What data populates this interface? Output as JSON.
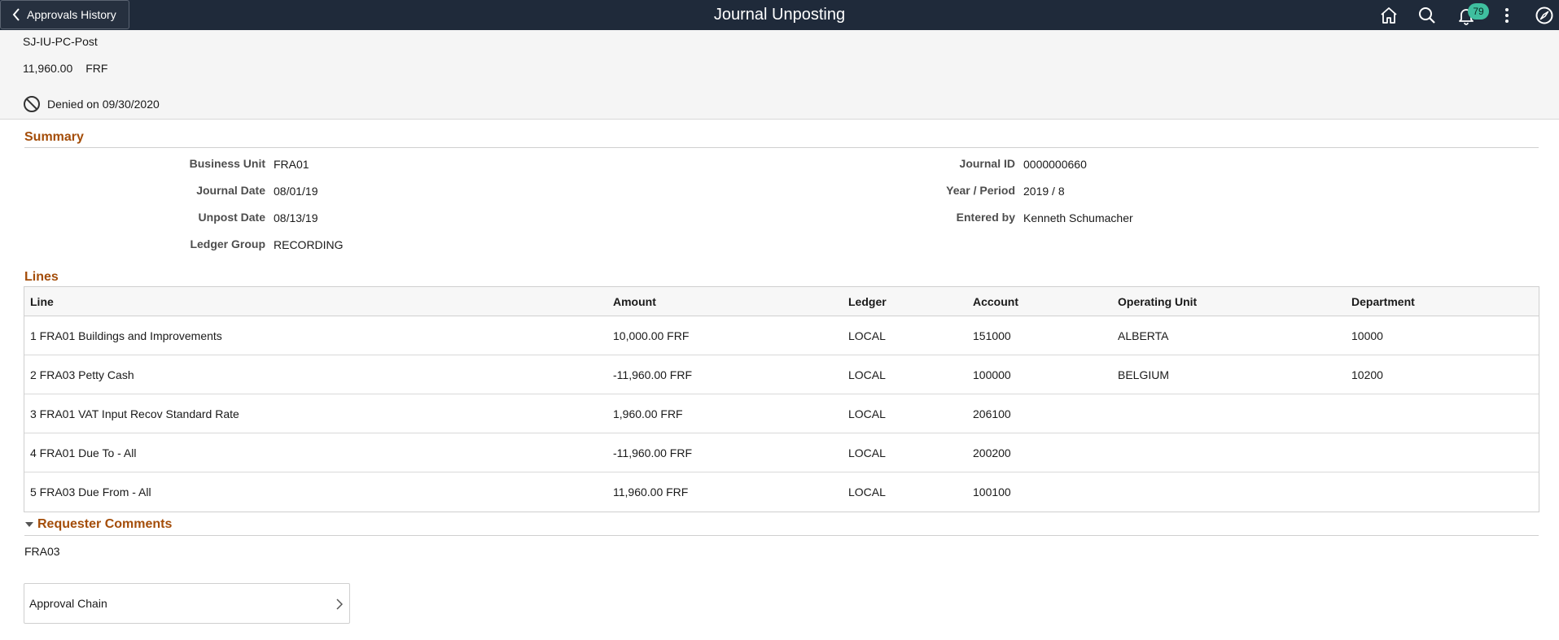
{
  "banner": {
    "back_label": "Approvals History",
    "title": "Journal Unposting",
    "notification_count": "79",
    "icons": [
      "home-icon",
      "search-icon",
      "bell-icon",
      "more-vertical-icon",
      "navbar-compass-icon"
    ],
    "bg_color": "#1f2a3a"
  },
  "header": {
    "transaction_id": "SJ-IU-PC-Post",
    "amount": "11,960.00",
    "currency": "FRF",
    "status": "Denied on 09/30/2020"
  },
  "summary": {
    "title": "Summary",
    "left_fields": [
      {
        "label": "Business Unit",
        "value": "FRA01"
      },
      {
        "label": "Journal Date",
        "value": "08/01/19"
      },
      {
        "label": "Unpost Date",
        "value": "08/13/19"
      },
      {
        "label": "Ledger Group",
        "value": "RECORDING"
      }
    ],
    "right_fields": [
      {
        "label": "Journal ID",
        "value": "0000000660"
      },
      {
        "label": "Year / Period",
        "value": "2019 / 8"
      },
      {
        "label": "Entered by",
        "value": "Kenneth Schumacher"
      }
    ]
  },
  "lines": {
    "title": "Lines",
    "columns": [
      "Line",
      "Amount",
      "Ledger",
      "Account",
      "Operating Unit",
      "Department"
    ],
    "rows": [
      [
        "1 FRA01 Buildings and Improvements",
        "10,000.00 FRF",
        "LOCAL",
        "151000",
        "ALBERTA",
        "10000"
      ],
      [
        "2 FRA03 Petty Cash",
        "-11,960.00 FRF",
        "LOCAL",
        "100000",
        "BELGIUM",
        "10200"
      ],
      [
        "3 FRA01 VAT Input Recov Standard Rate",
        "1,960.00 FRF",
        "LOCAL",
        "206100",
        "",
        ""
      ],
      [
        "4 FRA01 Due To - All",
        "-11,960.00 FRF",
        "LOCAL",
        "200200",
        "",
        ""
      ],
      [
        "5 FRA03 Due From - All",
        "11,960.00 FRF",
        "LOCAL",
        "100100",
        "",
        ""
      ]
    ]
  },
  "comments": {
    "title": "Requester Comments",
    "text": "FRA03"
  },
  "approval_chain": {
    "label": "Approval Chain"
  },
  "colors": {
    "section_title": "#a44d09",
    "badge": "#3fbf9f"
  }
}
